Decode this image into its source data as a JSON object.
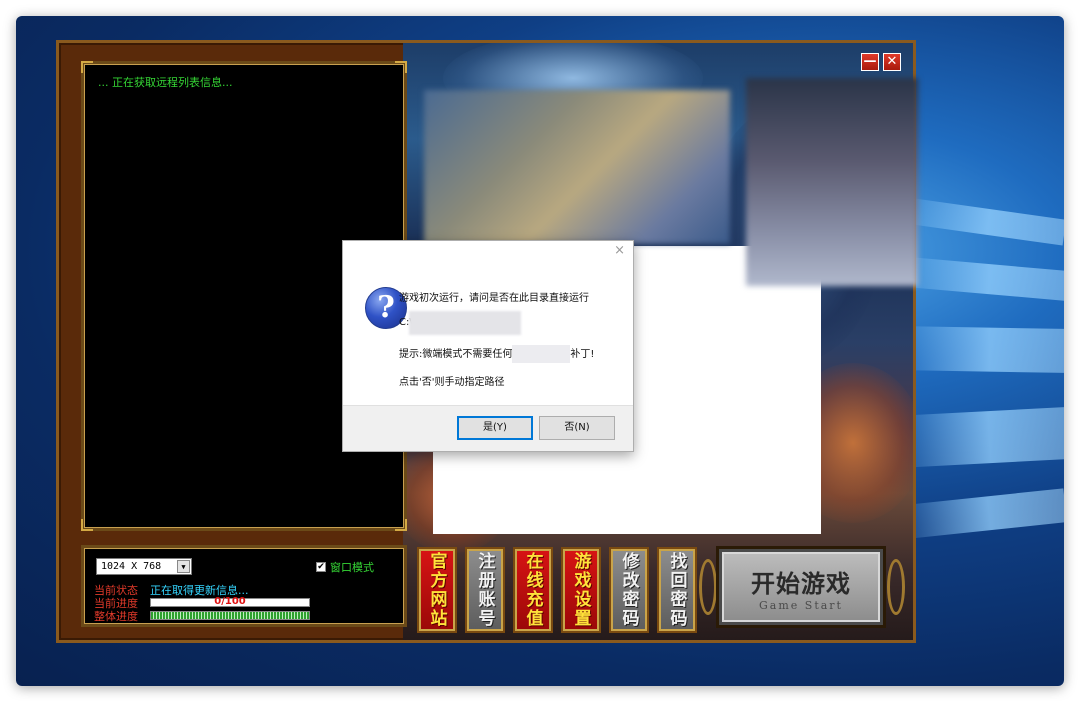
{
  "launcher": {
    "log_text": "... 正在获取远程列表信息...",
    "resolution": "1024 X 768",
    "window_mode": {
      "label": "窗口模式",
      "checked": true,
      "mark": "✔"
    },
    "status": {
      "current_state_label": "当前状态",
      "current_state_value": "正在取得更新信息...",
      "current_progress_label": "当前进度",
      "current_progress_text": "0/100",
      "total_progress_label": "整体进度",
      "total_progress": 1.0
    },
    "buttons": [
      {
        "label": "官方网站",
        "style": "red"
      },
      {
        "label": "注册账号",
        "style": "gray"
      },
      {
        "label": "在线充值",
        "style": "red"
      },
      {
        "label": "游戏设置",
        "style": "red"
      },
      {
        "label": "修改密码",
        "style": "gray"
      },
      {
        "label": "找回密码",
        "style": "gray"
      }
    ],
    "start": {
      "label": "开始游戏",
      "sub_label": "Game Start"
    },
    "window_buttons": {
      "minimize": "—",
      "close": "✕"
    }
  },
  "dialog": {
    "close_glyph": "×",
    "icon_glyph": "?",
    "line1": "游戏初次运行，请问是否在此目录直接运行",
    "line2": "C:\\",
    "line3_prefix": "提示:微端模式不需要任何",
    "line3_suffix": "补丁!",
    "line4": "点击'否'则手动指定路径",
    "yes_label": "是(Y)",
    "no_label": "否(N)"
  },
  "colors": {
    "log_green": "#35d635",
    "status_red": "#e23a2a",
    "status_cyan": "#35d6ff",
    "button_red": "#d81414",
    "button_gold_text": "#ffe23a",
    "dialog_accent": "#0078d7"
  }
}
